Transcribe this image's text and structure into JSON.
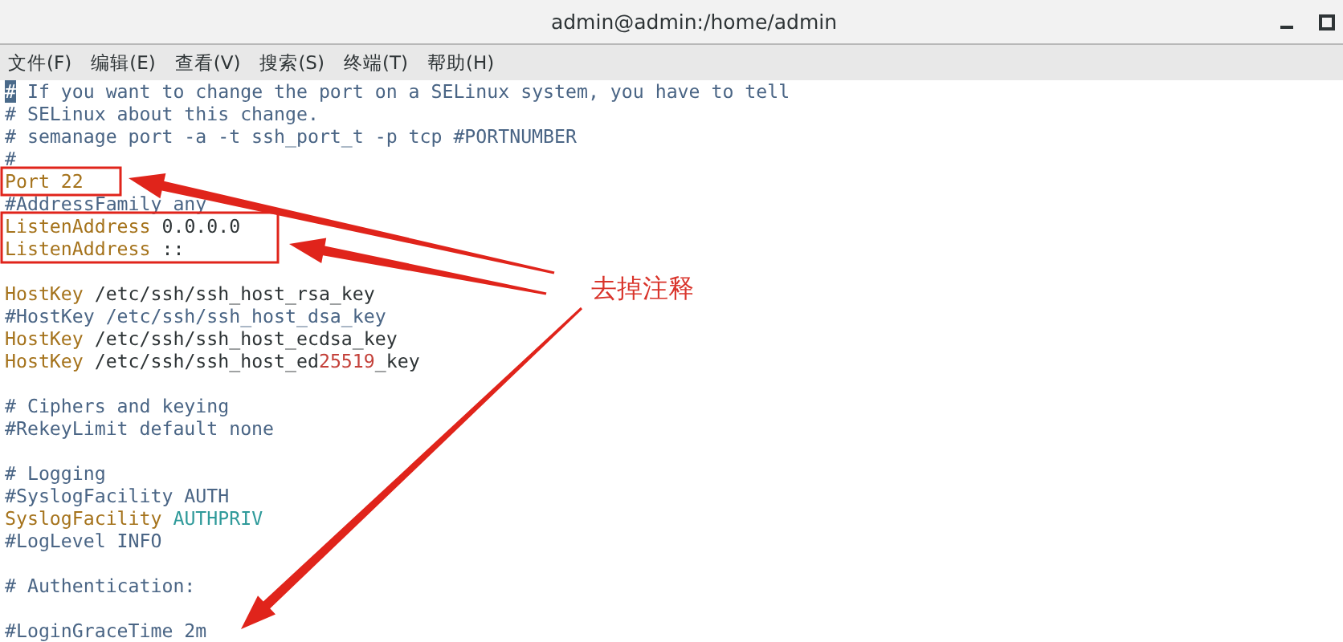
{
  "window": {
    "title": "admin@admin:/home/admin"
  },
  "menu": [
    "文件(F)",
    "编辑(E)",
    "查看(V)",
    "搜索(S)",
    "终端(T)",
    "帮助(H)"
  ],
  "blocks": [
    {
      "lines": [
        {
          "segments": [
            {
              "text": "#",
              "kind": "cursor"
            },
            {
              "text": " If you want to change the port on a SELinux system, you have to tell",
              "kind": "comment"
            }
          ]
        },
        {
          "segments": [
            {
              "text": "# SELinux about this change.",
              "kind": "comment"
            }
          ]
        },
        {
          "segments": [
            {
              "text": "# semanage port -a -t ssh_port_t -p tcp #PORTNUMBER",
              "kind": "comment"
            }
          ]
        },
        {
          "segments": [
            {
              "text": "#",
              "kind": "comment"
            }
          ]
        },
        {
          "segments": [
            {
              "text": "Port 22",
              "kind": "keyword"
            }
          ]
        },
        {
          "segments": [
            {
              "text": "#AddressFamily any",
              "kind": "comment"
            }
          ]
        },
        {
          "segments": [
            {
              "text": "ListenAddress",
              "kind": "keyword"
            },
            {
              "text": " 0.0.0.0",
              "kind": "value"
            }
          ]
        },
        {
          "segments": [
            {
              "text": "ListenAddress",
              "kind": "keyword"
            },
            {
              "text": " ::",
              "kind": "value"
            }
          ]
        }
      ]
    },
    {
      "lines": [
        {
          "segments": [
            {
              "text": "HostKey",
              "kind": "keyword"
            },
            {
              "text": " /etc/ssh/ssh_host_rsa_key",
              "kind": "value"
            }
          ]
        },
        {
          "segments": [
            {
              "text": "#HostKey /etc/ssh/ssh_host_dsa_key",
              "kind": "comment"
            }
          ]
        },
        {
          "segments": [
            {
              "text": "HostKey",
              "kind": "keyword"
            },
            {
              "text": " /etc/ssh/ssh_host_ecdsa_key",
              "kind": "value"
            }
          ]
        },
        {
          "segments": [
            {
              "text": "HostKey",
              "kind": "keyword"
            },
            {
              "text": " /etc/ssh/ssh_host_ed",
              "kind": "value"
            },
            {
              "text": "25519",
              "kind": "number"
            },
            {
              "text": "_key",
              "kind": "value"
            }
          ]
        }
      ]
    },
    {
      "lines": [
        {
          "segments": [
            {
              "text": "# Ciphers and keying",
              "kind": "comment"
            }
          ]
        },
        {
          "segments": [
            {
              "text": "#RekeyLimit default none",
              "kind": "comment"
            }
          ]
        }
      ]
    },
    {
      "lines": [
        {
          "segments": [
            {
              "text": "# Logging",
              "kind": "comment"
            }
          ]
        },
        {
          "segments": [
            {
              "text": "#SyslogFacility AUTH",
              "kind": "comment"
            }
          ]
        },
        {
          "segments": [
            {
              "text": "SyslogFacility",
              "kind": "keyword"
            },
            {
              "text": " AUTHPRIV",
              "kind": "constant"
            }
          ]
        },
        {
          "segments": [
            {
              "text": "#LogLevel INFO",
              "kind": "comment"
            }
          ]
        }
      ]
    },
    {
      "lines": [
        {
          "segments": [
            {
              "text": "# Authentication:",
              "kind": "comment"
            }
          ]
        }
      ]
    },
    {
      "lines": [
        {
          "segments": [
            {
              "text": "#LoginGraceTime 2m",
              "kind": "comment"
            }
          ]
        }
      ]
    }
  ],
  "annotation": {
    "label": "去掉注释"
  }
}
